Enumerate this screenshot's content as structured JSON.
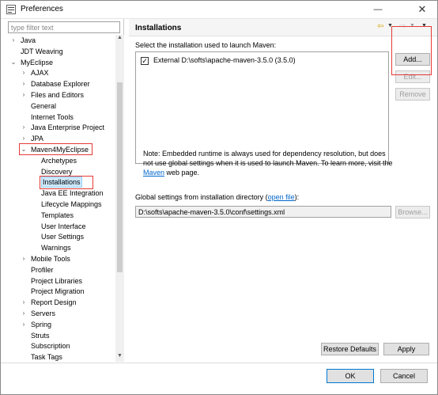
{
  "window": {
    "title": "Preferences",
    "minimize": "—",
    "close": "✕"
  },
  "filter": {
    "placeholder": "type filter text"
  },
  "tree": [
    {
      "label": "Java",
      "arrow": "›"
    },
    {
      "label": "JDT Weaving",
      "arrow": ""
    },
    {
      "label": "MyEclipse",
      "arrow": "⌄"
    },
    {
      "label": "AJAX",
      "arrow": "›"
    },
    {
      "label": "Database Explorer",
      "arrow": "›"
    },
    {
      "label": "Files and Editors",
      "arrow": "›"
    },
    {
      "label": "General",
      "arrow": ""
    },
    {
      "label": "Internet Tools",
      "arrow": ""
    },
    {
      "label": "Java Enterprise Project",
      "arrow": "›"
    },
    {
      "label": "JPA",
      "arrow": "›"
    },
    {
      "label": "Maven4MyEclipse",
      "arrow": "⌄"
    },
    {
      "label": "Archetypes",
      "arrow": ""
    },
    {
      "label": "Discovery",
      "arrow": ""
    },
    {
      "label": "Installations",
      "arrow": ""
    },
    {
      "label": "Java EE Integration",
      "arrow": ""
    },
    {
      "label": "Lifecycle Mappings",
      "arrow": ""
    },
    {
      "label": "Templates",
      "arrow": ""
    },
    {
      "label": "User Interface",
      "arrow": ""
    },
    {
      "label": "User Settings",
      "arrow": ""
    },
    {
      "label": "Warnings",
      "arrow": ""
    },
    {
      "label": "Mobile Tools",
      "arrow": "›"
    },
    {
      "label": "Profiler",
      "arrow": ""
    },
    {
      "label": "Project Libraries",
      "arrow": ""
    },
    {
      "label": "Project Migration",
      "arrow": ""
    },
    {
      "label": "Report Design",
      "arrow": "›"
    },
    {
      "label": "Servers",
      "arrow": "›"
    },
    {
      "label": "Spring",
      "arrow": "›"
    },
    {
      "label": "Struts",
      "arrow": ""
    },
    {
      "label": "Subscription",
      "arrow": ""
    },
    {
      "label": "Task Tags",
      "arrow": ""
    }
  ],
  "page": {
    "title": "Installations",
    "select_label": "Select the installation used to launch Maven:",
    "installation_entry": "External D:\\softs\\apache-maven-3.5.0 (3.5.0)",
    "installation_checked": "✓",
    "buttons": {
      "add": "Add...",
      "edit": "Edit...",
      "remove": "Remove"
    },
    "note_part1": "Note: Embedded runtime is always used for dependency resolution, but does not use global settings when it is used to launch Maven. To learn more, visit the ",
    "note_link": "Maven",
    "note_part2": " web page.",
    "global_label_prefix": "Global settings from installation directory (",
    "global_label_link": "open file",
    "global_label_suffix": "):",
    "global_path": "D:\\softs\\apache-maven-3.5.0\\conf\\settings.xml",
    "browse": "Browse...",
    "restore_defaults": "Restore Defaults",
    "apply": "Apply"
  },
  "footer": {
    "ok": "OK",
    "cancel": "Cancel"
  }
}
